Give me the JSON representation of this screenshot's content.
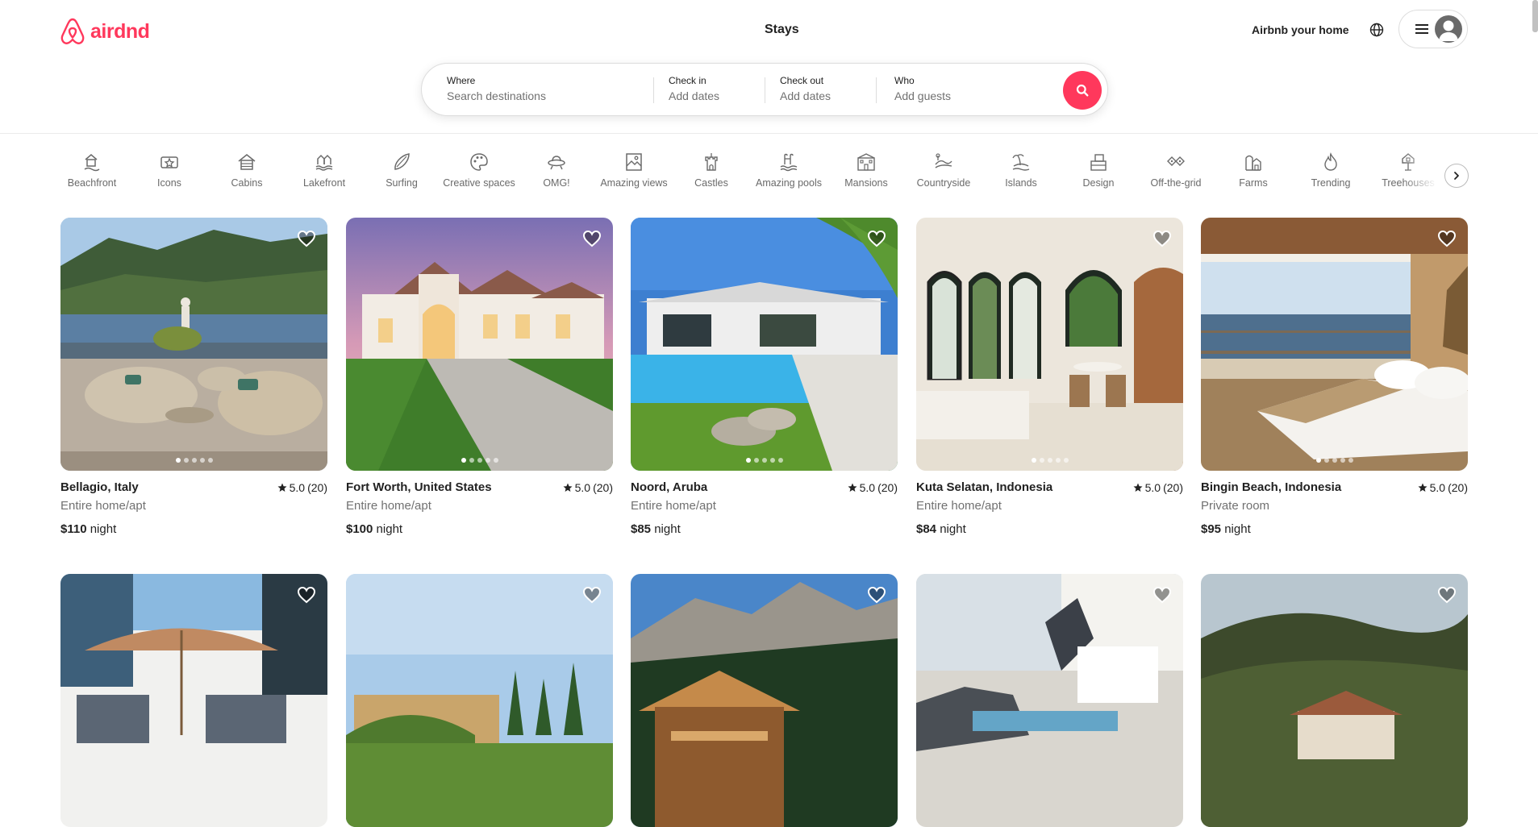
{
  "brand": {
    "name": "airdnd",
    "color": "#ff385c"
  },
  "header": {
    "center_label": "Stays",
    "host_link": "Airbnb your home",
    "globe_icon": "globe-icon",
    "menu_icon": "hamburger-menu-icon"
  },
  "search": {
    "where": {
      "label": "Where",
      "placeholder": "Search destinations"
    },
    "check_in": {
      "label": "Check in",
      "value": "Add dates"
    },
    "check_out": {
      "label": "Check out",
      "value": "Add dates"
    },
    "who": {
      "label": "Who",
      "value": "Add guests"
    },
    "button_icon": "search-icon"
  },
  "categories": [
    {
      "label": "Beachfront",
      "icon": "beachfront-icon"
    },
    {
      "label": "Icons",
      "icon": "icons-icon"
    },
    {
      "label": "Cabins",
      "icon": "cabin-icon"
    },
    {
      "label": "Lakefront",
      "icon": "lakefront-icon"
    },
    {
      "label": "Surfing",
      "icon": "surfboard-icon"
    },
    {
      "label": "Creative spaces",
      "icon": "palette-icon"
    },
    {
      "label": "OMG!",
      "icon": "ufo-icon"
    },
    {
      "label": "Amazing views",
      "icon": "view-icon"
    },
    {
      "label": "Castles",
      "icon": "castle-icon"
    },
    {
      "label": "Amazing pools",
      "icon": "pool-icon"
    },
    {
      "label": "Mansions",
      "icon": "mansion-icon"
    },
    {
      "label": "Countryside",
      "icon": "countryside-icon"
    },
    {
      "label": "Islands",
      "icon": "island-icon"
    },
    {
      "label": "Design",
      "icon": "design-icon"
    },
    {
      "label": "Off-the-grid",
      "icon": "off-grid-icon"
    },
    {
      "label": "Farms",
      "icon": "farm-icon"
    },
    {
      "label": "Trending",
      "icon": "flame-icon"
    },
    {
      "label": "Treehouses",
      "icon": "treehouse-icon"
    }
  ],
  "listings": [
    {
      "location": "Bellagio, Italy",
      "rating": "5.0",
      "reviews": "(20)",
      "type": "Entire home/apt",
      "price": "$110",
      "unit": "night"
    },
    {
      "location": "Fort Worth, United States",
      "rating": "5.0",
      "reviews": "(20)",
      "type": "Entire home/apt",
      "price": "$100",
      "unit": "night"
    },
    {
      "location": "Noord, Aruba",
      "rating": "5.0",
      "reviews": "(20)",
      "type": "Entire home/apt",
      "price": "$85",
      "unit": "night"
    },
    {
      "location": "Kuta Selatan, Indonesia",
      "rating": "5.0",
      "reviews": "(20)",
      "type": "Entire home/apt",
      "price": "$84",
      "unit": "night"
    },
    {
      "location": "Bingin Beach, Indonesia",
      "rating": "5.0",
      "reviews": "(20)",
      "type": "Private room",
      "price": "$95",
      "unit": "night"
    }
  ]
}
